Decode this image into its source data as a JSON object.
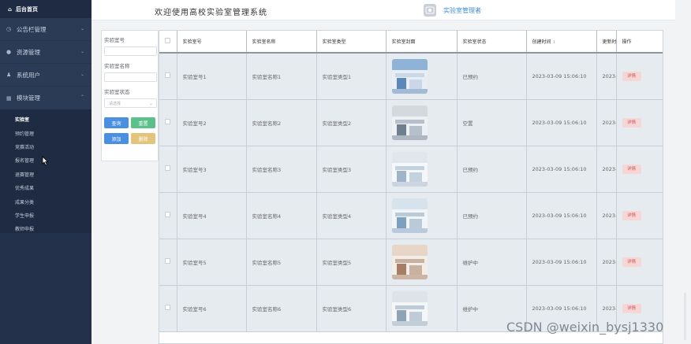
{
  "sidebar": {
    "home": "后台首页",
    "menus": [
      {
        "label": "公告栏管理",
        "icon": "clock-icon"
      },
      {
        "label": "资源管理",
        "icon": "location-icon"
      },
      {
        "label": "系统用户",
        "icon": "user-icon"
      },
      {
        "label": "模块管理",
        "icon": "grid-icon"
      }
    ],
    "submenu": [
      "实验室",
      "预约管理",
      "竞赛活动",
      "报名管理",
      "退赛管理",
      "优秀成果",
      "成果分类",
      "学生申报",
      "教师申报"
    ],
    "active_sub": 0
  },
  "header": {
    "title": "欢迎使用高校实验室管理系统",
    "user": "实验室管理者"
  },
  "search": {
    "field1_label": "实验室号",
    "field2_label": "实验室名称",
    "field3_label": "实验室状态",
    "select_placeholder": "请选择",
    "btn_query": "查询",
    "btn_reset": "重置",
    "btn_add": "添加",
    "btn_delete": "删除"
  },
  "table": {
    "columns": [
      "实验室号",
      "实验室名称",
      "实验室类型",
      "实验室封面",
      "实验室状态",
      "创建时间",
      "更新时间",
      "操作"
    ],
    "detail_label": "详情",
    "rows": [
      {
        "no": "实验室号1",
        "name": "实验室名称1",
        "type": "实验室类型1",
        "status": "已预约",
        "created": "2023-03-09 15:06:10",
        "updated": "2023-"
      },
      {
        "no": "实验室号2",
        "name": "实验室名称2",
        "type": "实验室类型2",
        "status": "空置",
        "created": "2023-03-09 15:06:10",
        "updated": "2023-"
      },
      {
        "no": "实验室号3",
        "name": "实验室名称3",
        "type": "实验室类型3",
        "status": "已预约",
        "created": "2023-03-09 15:06:10",
        "updated": "2023-"
      },
      {
        "no": "实验室号4",
        "name": "实验室名称4",
        "type": "实验室类型4",
        "status": "已预约",
        "created": "2023-03-09 15:06:10",
        "updated": "2023-"
      },
      {
        "no": "实验室号5",
        "name": "实验室名称5",
        "type": "实验室类型5",
        "status": "维护中",
        "created": "2023-03-09 15:06:10",
        "updated": "2023-"
      },
      {
        "no": "实验室号6",
        "name": "实验室名称6",
        "type": "实验室类型6",
        "status": "维护中",
        "created": "2023-03-09 15:06:10",
        "updated": "2023-"
      }
    ]
  },
  "watermark": "CSDN @weixin_bysj1330",
  "colors": {
    "sidebar_bg": "#2b3a55",
    "accent_blue": "#4a90e2",
    "accent_green": "#5cc08a",
    "accent_yellow": "#e3c47b",
    "detail_bg": "#f7d6d6"
  }
}
